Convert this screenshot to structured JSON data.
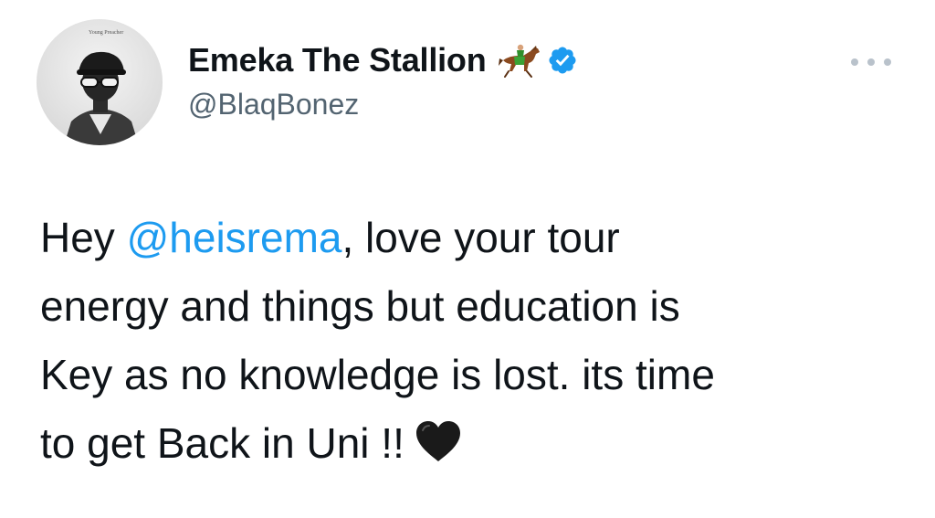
{
  "user": {
    "display_name": "Emeka The Stallion",
    "handle": "@BlaqBonez",
    "avatar_caption": "Young Preacher",
    "name_emoji": "racehorse-icon",
    "verified_icon": "verified-badge-icon"
  },
  "menu": {
    "icon": "more-options-icon"
  },
  "tweet": {
    "text_before": "Hey ",
    "mention": "@heisrema",
    "text_line1_after": ", love your tour",
    "line2": "energy and things but education is",
    "line3": "Key as no knowledge is lost. its time",
    "line4": "to get Back in Uni !!",
    "end_emoji": "black-heart-icon"
  },
  "colors": {
    "accent": "#1d9bf0",
    "text": "#0f1419",
    "secondary": "#536471"
  }
}
